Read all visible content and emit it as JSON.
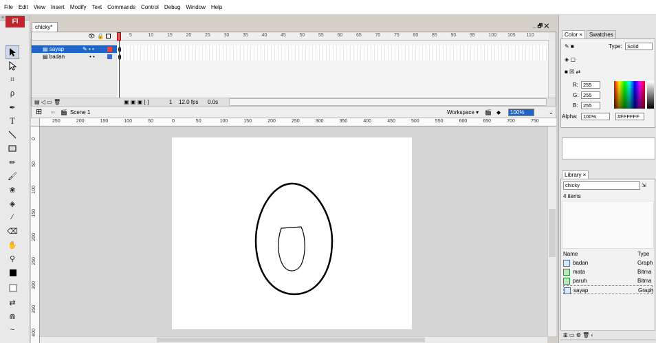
{
  "menu": [
    "File",
    "Edit",
    "View",
    "Insert",
    "Modify",
    "Text",
    "Commands",
    "Control",
    "Debug",
    "Window",
    "Help"
  ],
  "toolbar": {
    "logo": "Fl",
    "grip": "»"
  },
  "document": {
    "tab": "chicky*",
    "window_controls": "_ 🗗 ✕"
  },
  "timeline": {
    "layers": [
      {
        "name": "sayap",
        "selected": true
      },
      {
        "name": "badan",
        "selected": false
      }
    ],
    "frame_numbers": [
      "5",
      "10",
      "15",
      "20",
      "25",
      "30",
      "35",
      "40",
      "45",
      "50",
      "55",
      "60",
      "65",
      "70",
      "75",
      "80",
      "85",
      "90",
      "95",
      "100",
      "105",
      "110"
    ],
    "current_frame": "1",
    "fps": "12.0 fps",
    "time": "0.0s"
  },
  "scenebar": {
    "scene": "Scene 1",
    "workspace": "Workspace ▾",
    "zoom": "100%"
  },
  "ruler": {
    "h_ticks": [
      "250",
      "200",
      "150",
      "100",
      "50",
      "0",
      "50",
      "100",
      "150",
      "200",
      "250",
      "300",
      "350",
      "400",
      "450",
      "500",
      "550",
      "600",
      "650",
      "700",
      "750"
    ],
    "v_ticks": [
      "0",
      "50",
      "100",
      "150",
      "200",
      "250",
      "300",
      "350",
      "400"
    ]
  },
  "color_panel": {
    "tab_color": "Color ×",
    "tab_swatches": "Swatches",
    "type_label": "Type:",
    "type_value": "Solid",
    "r_label": "R:",
    "r_value": "255",
    "g_label": "G:",
    "g_value": "255",
    "b_label": "B:",
    "b_value": "255",
    "alpha_label": "Alpha:",
    "alpha_value": "100%",
    "hex": "#FFFFFF"
  },
  "library": {
    "tab": "Library ×",
    "doc": "chicky",
    "count": "4 items",
    "col_name": "Name",
    "col_type": "Type",
    "items": [
      {
        "name": "badan",
        "type": "Graph",
        "kind": "graphic"
      },
      {
        "name": "mata",
        "type": "Bitma",
        "kind": "bitmap"
      },
      {
        "name": "paruh",
        "type": "Bitma",
        "kind": "bitmap"
      },
      {
        "name": "sayap",
        "type": "Graph",
        "kind": "graphic"
      }
    ]
  },
  "colors": {
    "selection": "#1f65c8",
    "logo": "#c0262b",
    "playhead": "#e00000"
  }
}
